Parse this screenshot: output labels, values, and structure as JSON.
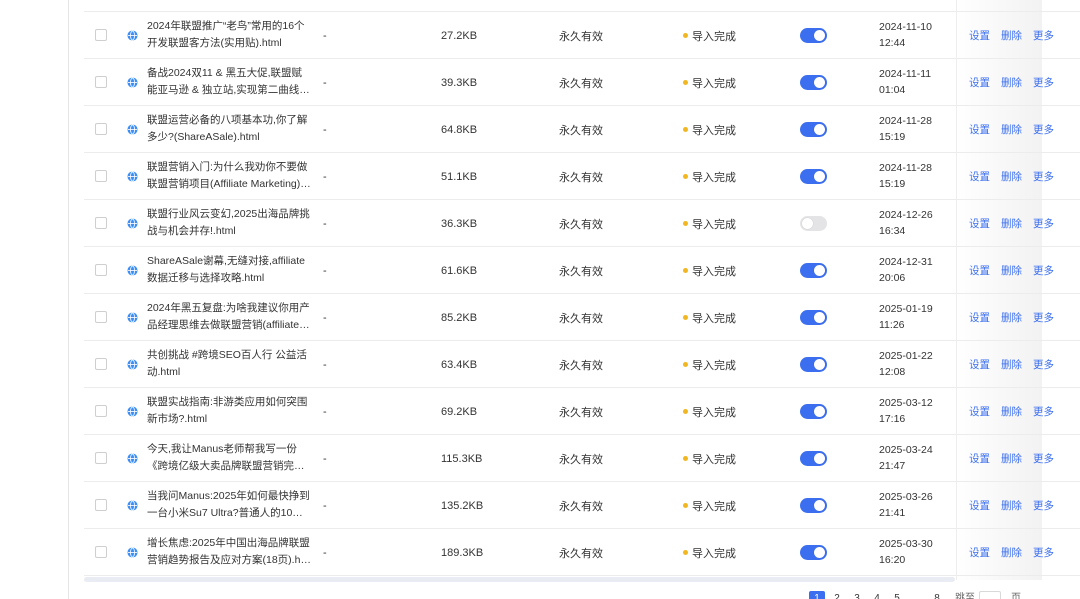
{
  "table": {
    "rows": [
      {
        "title": "2024年联盟推广“老鸟”常用的16个开发联盟客方法(实用贴).html",
        "tag": "-",
        "size": "27.2KB",
        "validity": "永久有效",
        "status": "导入完成",
        "enabled": true,
        "date": "2024-11-10",
        "time": "12:44"
      },
      {
        "title": "备战2024双11 & 黑五大促,联盟赋能亚马逊 & 独立站,实现第二曲线.html",
        "tag": "-",
        "size": "39.3KB",
        "validity": "永久有效",
        "status": "导入完成",
        "enabled": true,
        "date": "2024-11-11",
        "time": "01:04"
      },
      {
        "title": "联盟运营必备的八项基本功,你了解多少?(ShareASale).html",
        "tag": "-",
        "size": "64.8KB",
        "validity": "永久有效",
        "status": "导入完成",
        "enabled": true,
        "date": "2024-11-28",
        "time": "15:19"
      },
      {
        "title": "联盟营销入门:为什么我劝你不要做联盟营销项目(Affiliate Marketing).html",
        "tag": "-",
        "size": "51.1KB",
        "validity": "永久有效",
        "status": "导入完成",
        "enabled": true,
        "date": "2024-11-28",
        "time": "15:19"
      },
      {
        "title": "联盟行业风云变幻,2025出海品牌挑战与机会并存!.html",
        "tag": "-",
        "size": "36.3KB",
        "validity": "永久有效",
        "status": "导入完成",
        "enabled": false,
        "date": "2024-12-26",
        "time": "16:34"
      },
      {
        "title": "ShareASale谢幕,无缝对接,affiliate数据迁移与选择攻略.html",
        "tag": "-",
        "size": "61.6KB",
        "validity": "永久有效",
        "status": "导入完成",
        "enabled": true,
        "date": "2024-12-31",
        "time": "20:06"
      },
      {
        "title": "2024年黑五复盘:为啥我建议你用产品经理思维去做联盟营销(affiliate).html",
        "tag": "-",
        "size": "85.2KB",
        "validity": "永久有效",
        "status": "导入完成",
        "enabled": true,
        "date": "2025-01-19",
        "time": "11:26"
      },
      {
        "title": "共创挑战 #跨境SEO百人行 公益活动.html",
        "tag": "-",
        "size": "63.4KB",
        "validity": "永久有效",
        "status": "导入完成",
        "enabled": true,
        "date": "2025-01-22",
        "time": "12:08"
      },
      {
        "title": "联盟实战指南:非游类应用如何突围新市场?.html",
        "tag": "-",
        "size": "69.2KB",
        "validity": "永久有效",
        "status": "导入完成",
        "enabled": true,
        "date": "2025-03-12",
        "time": "17:16"
      },
      {
        "title": "今天,我让Manus老师帮我写一份《跨境亿级大卖品牌联盟营销完整方案》.html",
        "tag": "-",
        "size": "115.3KB",
        "validity": "永久有效",
        "status": "导入完成",
        "enabled": true,
        "date": "2025-03-24",
        "time": "21:47"
      },
      {
        "title": "当我问Manus:2025年如何最快挣到一台小米Su7 Ultra?普通人的10个方法.html",
        "tag": "-",
        "size": "135.2KB",
        "validity": "永久有效",
        "status": "导入完成",
        "enabled": true,
        "date": "2025-03-26",
        "time": "21:41"
      },
      {
        "title": "增长焦虑:2025年中国出海品牌联盟营销趋势报告及应对方案(18页).html",
        "tag": "-",
        "size": "189.3KB",
        "validity": "永久有效",
        "status": "导入完成",
        "enabled": true,
        "date": "2025-03-30",
        "time": "16:20"
      }
    ],
    "actions": {
      "settings": "设置",
      "delete": "删除",
      "more": "更多"
    }
  },
  "footer": {
    "total_text": "",
    "pages": [
      "1",
      "2",
      "3",
      "4",
      "5",
      "...",
      "8"
    ],
    "goto_label": "跳至",
    "page_suffix": "页"
  },
  "colors": {
    "accent": "#3c6ff0",
    "status_dot": "#f2b620"
  }
}
